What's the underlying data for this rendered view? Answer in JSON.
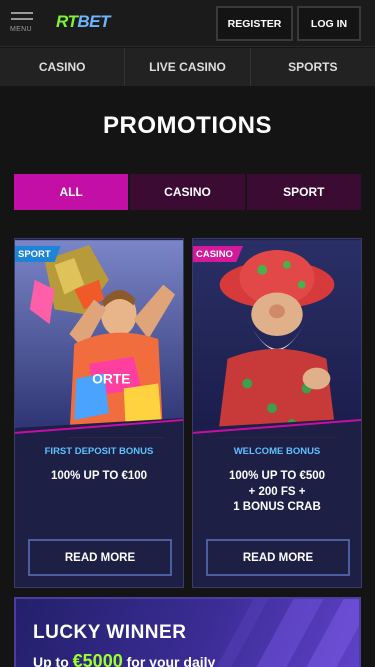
{
  "header": {
    "menu_label": "MENU",
    "logo": {
      "part1": "RT",
      "part2": "BET"
    },
    "register_label": "REGISTER",
    "login_label": "LOG IN"
  },
  "nav": {
    "items": [
      {
        "label": "CASINO"
      },
      {
        "label": "LIVE CASINO"
      },
      {
        "label": "SPORTS"
      }
    ]
  },
  "page": {
    "title": "PROMOTIONS"
  },
  "filters": {
    "items": [
      {
        "label": "ALL",
        "active": true
      },
      {
        "label": "CASINO",
        "active": false
      },
      {
        "label": "SPORT",
        "active": false
      }
    ]
  },
  "promos": [
    {
      "badge": "SPORT",
      "title": "FIRST DEPOSIT BONUS",
      "desc_lines": [
        "100% UP TO €100"
      ],
      "button": "READ MORE"
    },
    {
      "badge": "CASINO",
      "title": "WELCOME BONUS",
      "desc_lines": [
        "100% UP TO €500",
        "+ 200 FS +",
        "1 BONUS CRAB"
      ],
      "button": "READ MORE"
    }
  ],
  "banner": {
    "title": "LUCKY WINNER",
    "sub_prefix": "Up to",
    "amount": "€5000",
    "sub_suffix": "for your daily"
  },
  "colors": {
    "accent": "#c40fa7",
    "tab_inactive": "#3c0b33",
    "card_bg": "#1e1f45",
    "sport_badge": "#1e84d6",
    "casino_badge": "#d41a9b",
    "promo_title": "#5ec2ff",
    "logo_green": "#7cf23a",
    "logo_blue": "#6fb4ff"
  },
  "icons": [
    "hamburger-menu-icon"
  ]
}
